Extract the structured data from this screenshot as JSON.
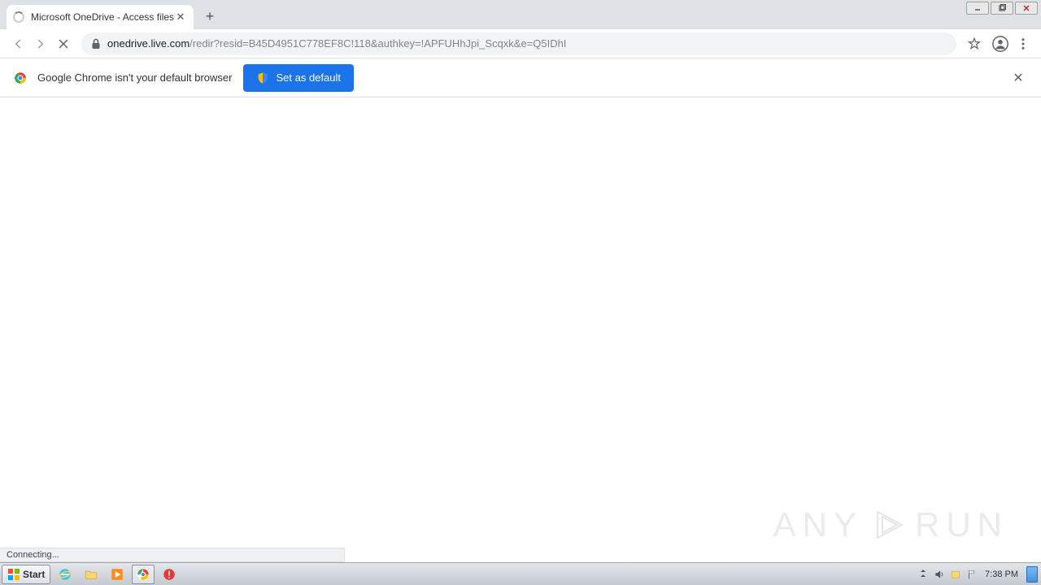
{
  "tab": {
    "title": "Microsoft OneDrive - Access files an"
  },
  "url": {
    "host": "onedrive.live.com",
    "path": "/redir?resid=B45D4951C778EF8C!118&authkey=!APFUHhJpi_Scqxk&e=Q5IDhI"
  },
  "infobar": {
    "message": "Google Chrome isn't your default browser",
    "button": "Set as default"
  },
  "status": "Connecting...",
  "watermark": {
    "left": "ANY",
    "right": "RUN"
  },
  "taskbar": {
    "start": "Start",
    "time": "7:38 PM"
  }
}
